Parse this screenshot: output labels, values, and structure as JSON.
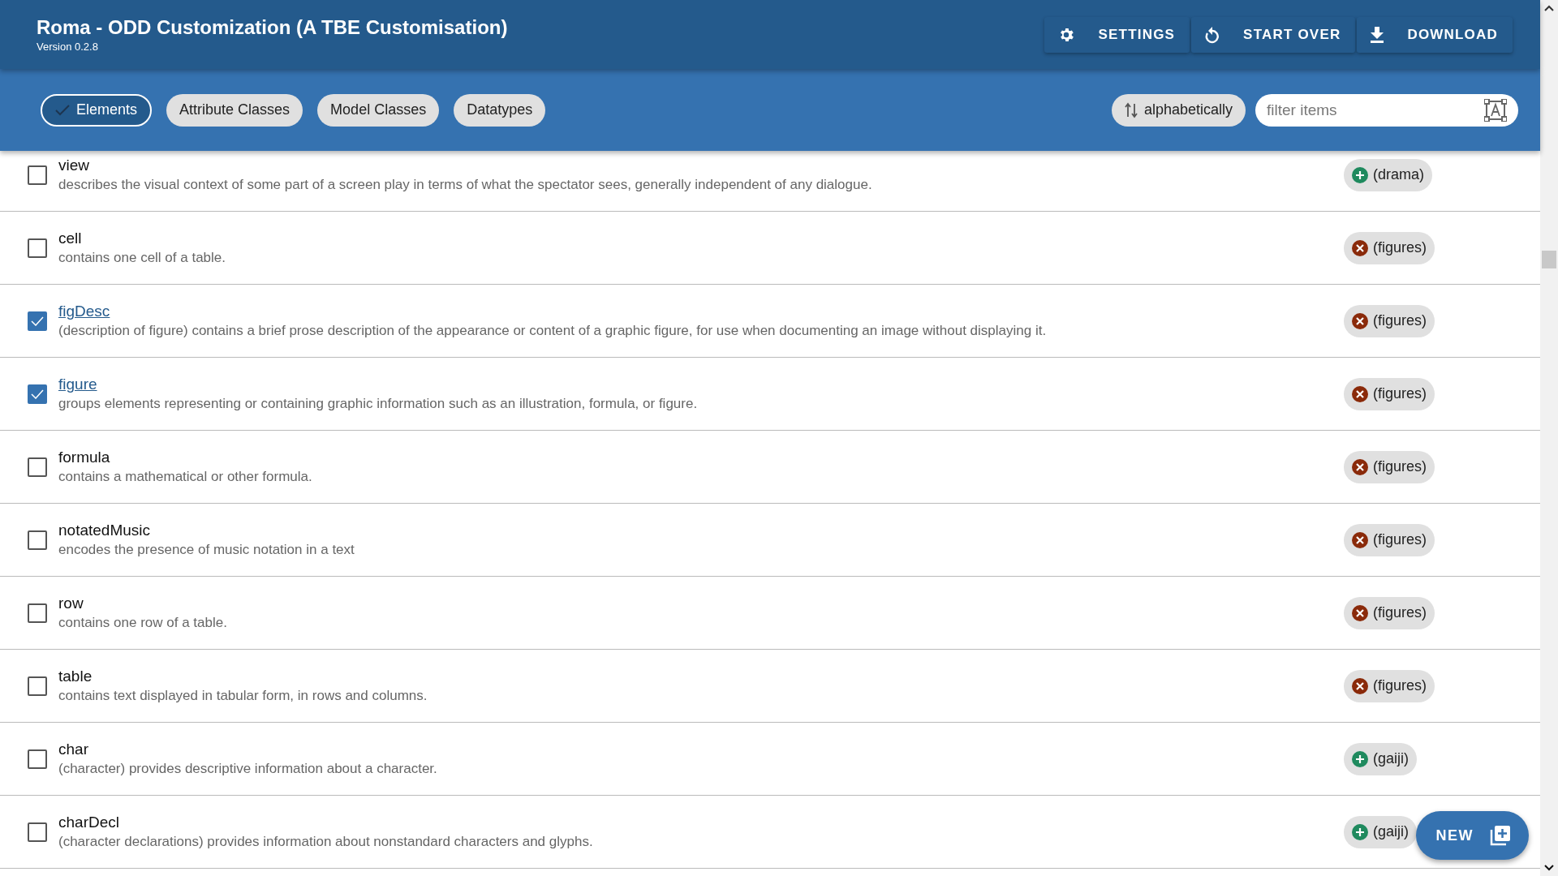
{
  "header": {
    "title": "Roma - ODD Customization (A TBE Customisation)",
    "version": "Version 0.2.8",
    "actions": [
      {
        "kind": "settings",
        "label": "SETTINGS"
      },
      {
        "kind": "restart",
        "label": "START OVER"
      },
      {
        "kind": "download",
        "label": "DOWNLOAD"
      }
    ]
  },
  "tabs": [
    {
      "label": "Elements",
      "selected": true
    },
    {
      "label": "Attribute Classes",
      "selected": false
    },
    {
      "label": "Model Classes",
      "selected": false
    },
    {
      "label": "Datatypes",
      "selected": false
    }
  ],
  "sort": {
    "label": "alphabetically"
  },
  "filter": {
    "placeholder": "filter items"
  },
  "rows": [
    {
      "name": "view",
      "description": "describes the visual context of some part of a screen play in terms of what the spectator sees, generally independent of any dialogue.",
      "checked": false,
      "chip": {
        "kind": "add",
        "label": "(drama)"
      }
    },
    {
      "name": "cell",
      "description": "contains one cell of a table.",
      "checked": false,
      "chip": {
        "kind": "remove",
        "label": "(figures)"
      }
    },
    {
      "name": "figDesc",
      "description": "(description of figure) contains a brief prose description of the appearance or content of a graphic figure, for use when documenting an image without displaying it.",
      "checked": true,
      "chip": {
        "kind": "remove",
        "label": "(figures)"
      }
    },
    {
      "name": "figure",
      "description": "groups elements representing or containing graphic information such as an illustration, formula, or figure.",
      "checked": true,
      "chip": {
        "kind": "remove",
        "label": "(figures)"
      }
    },
    {
      "name": "formula",
      "description": "contains a mathematical or other formula.",
      "checked": false,
      "chip": {
        "kind": "remove",
        "label": "(figures)"
      }
    },
    {
      "name": "notatedMusic",
      "description": "encodes the presence of music notation in a text",
      "checked": false,
      "chip": {
        "kind": "remove",
        "label": "(figures)"
      }
    },
    {
      "name": "row",
      "description": "contains one row of a table.",
      "checked": false,
      "chip": {
        "kind": "remove",
        "label": "(figures)"
      }
    },
    {
      "name": "table",
      "description": "contains text displayed in tabular form, in rows and columns.",
      "checked": false,
      "chip": {
        "kind": "remove",
        "label": "(figures)"
      }
    },
    {
      "name": "char",
      "description": "(character) provides descriptive information about a character.",
      "checked": false,
      "chip": {
        "kind": "add",
        "label": "(gaiji)"
      }
    },
    {
      "name": "charDecl",
      "description": "(character declarations) provides information about nonstandard characters and glyphs.",
      "checked": false,
      "chip": {
        "kind": "add",
        "label": "(gaiji)"
      }
    }
  ],
  "fab": {
    "label": "NEW"
  }
}
